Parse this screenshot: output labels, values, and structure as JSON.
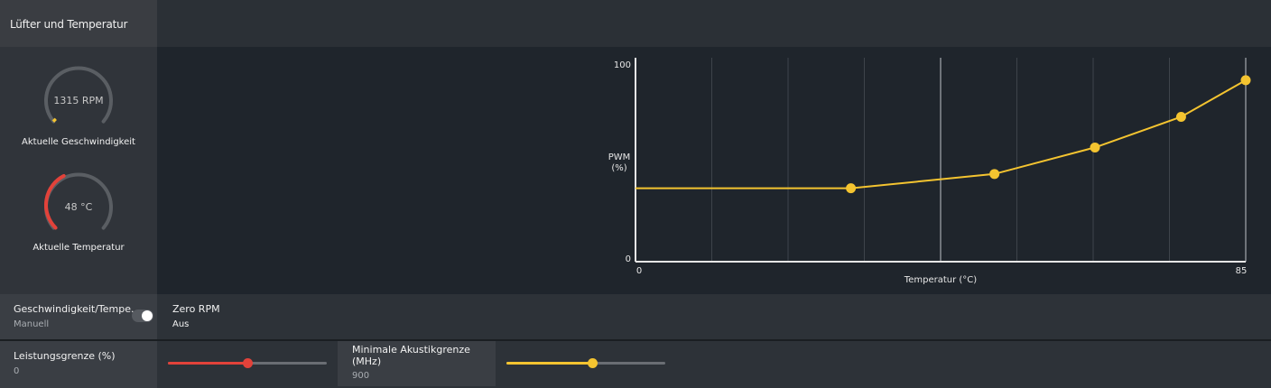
{
  "window": {
    "title": "Lüfter und Temperatur"
  },
  "gauges": {
    "speed": {
      "value": "1315 RPM",
      "label": "Aktuelle Geschwindigkeit",
      "level": 0.02,
      "color": "#f4c430"
    },
    "temperature": {
      "value": "48 °C",
      "label": "Aktuelle Temperatur",
      "level": 0.4,
      "color": "#e2423a"
    }
  },
  "fan_curve": {
    "ylabel_line1": "PWM",
    "ylabel_line2": "(%)",
    "xlabel": "Temperatur (°C)",
    "y_max_label": "100",
    "y_min_label": "0",
    "x_min_label": "0",
    "x_max_label": "85",
    "line_color": "#f4c430"
  },
  "chart_data": {
    "type": "line",
    "xlabel": "Temperatur (°C)",
    "ylabel": "PWM (%)",
    "xlim": [
      0,
      85
    ],
    "ylim": [
      0,
      100
    ],
    "grid": true,
    "series": [
      {
        "x": [
          0,
          30,
          50,
          64,
          76,
          85
        ],
        "y": [
          36,
          36,
          43,
          56,
          71,
          89
        ],
        "markers": [
          false,
          true,
          true,
          true,
          true,
          true
        ]
      }
    ]
  },
  "controls": {
    "mode": {
      "label": "Geschwindigkeit/Tempe...",
      "value": "Manuell",
      "toggle_on": true
    },
    "zero_rpm": {
      "label": "Zero RPM",
      "value": "Aus"
    },
    "power_limit": {
      "label": "Leistungsgrenze (%)",
      "value": "0",
      "level": 0.5,
      "color": "#e2423a"
    },
    "acoustic_limit": {
      "label_line1": "Minimale Akustikgrenze",
      "label_line2": "(MHz)",
      "value": "900",
      "level": 0.54,
      "color": "#f4c430"
    }
  }
}
